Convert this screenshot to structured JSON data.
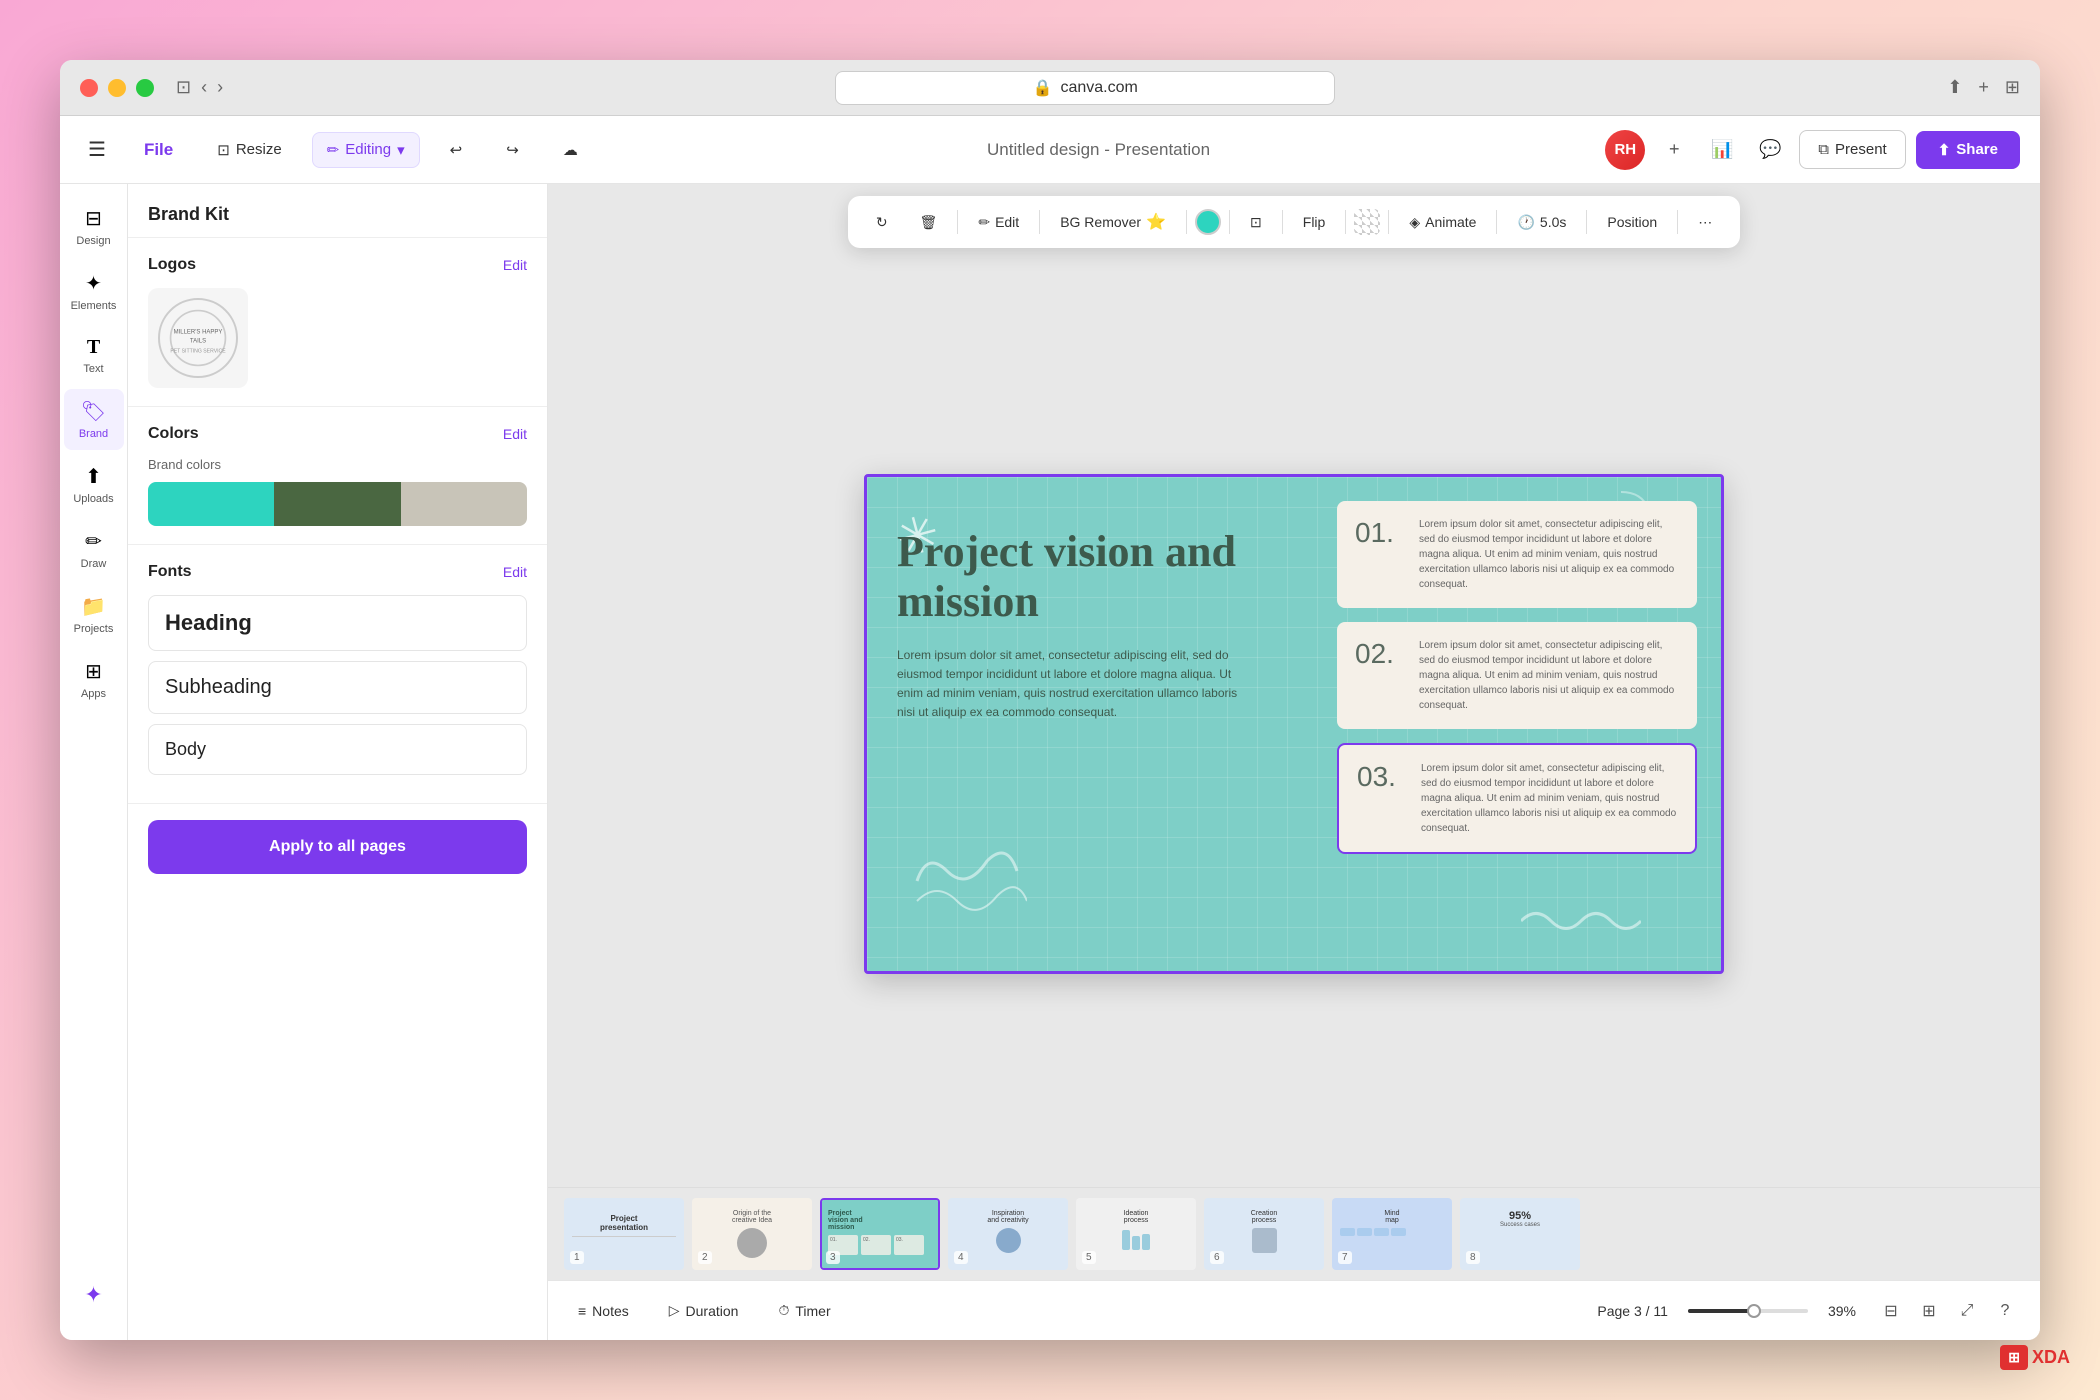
{
  "window": {
    "url": "canva.com",
    "title": "Untitled design - Presentation"
  },
  "toolbar": {
    "hamburger": "☰",
    "file": "File",
    "resize": "Resize",
    "editing": "Editing",
    "undo": "↩",
    "redo": "↪",
    "cloud": "☁",
    "title": "Untitled design - Presentation",
    "avatar": "RH",
    "add": "+",
    "chart": "📊",
    "comment": "💬",
    "present": "Present",
    "share": "Share"
  },
  "floating_toolbar": {
    "refresh": "↻",
    "trash": "🗑",
    "edit": "Edit",
    "bg_remover": "BG Remover",
    "flip": "Flip",
    "animate": "Animate",
    "duration": "5.0s",
    "position": "Position"
  },
  "left_panel": {
    "title": "Brand Kit",
    "logos_section": "Logos",
    "logos_edit": "Edit",
    "colors_section": "Colors",
    "colors_edit": "Edit",
    "brand_colors_label": "Brand colors",
    "fonts_section": "Fonts",
    "fonts_edit": "Edit",
    "heading_label": "Heading",
    "subheading_label": "Subheading",
    "body_label": "Body",
    "apply_button": "Apply to all pages"
  },
  "sidebar_icons": [
    {
      "icon": "☰",
      "label": "Design",
      "active": false
    },
    {
      "icon": "✦",
      "label": "Elements",
      "active": false
    },
    {
      "icon": "T",
      "label": "Text",
      "active": false
    },
    {
      "icon": "🏷",
      "label": "Brand",
      "active": true
    },
    {
      "icon": "⬆",
      "label": "Uploads",
      "active": false
    },
    {
      "icon": "✏",
      "label": "Draw",
      "active": false
    },
    {
      "icon": "📁",
      "label": "Projects",
      "active": false
    },
    {
      "icon": "⊞",
      "label": "Apps",
      "active": false
    }
  ],
  "colors": [
    {
      "hex": "#2dd4bf"
    },
    {
      "hex": "#4a6741"
    },
    {
      "hex": "#c8c4b8"
    }
  ],
  "slide": {
    "title": "Project vision and mission",
    "body_text": "Lorem ipsum dolor sit amet, consectetur adipiscing elit, sed do eiusmod tempor incididunt ut labore et dolore magna aliqua. Ut enim ad minim veniam, quis nostrud exercitation ullamco laboris nisi ut aliquip ex ea commodo consequat.",
    "cards": [
      {
        "number": "01.",
        "text": "Lorem ipsum dolor sit amet, consectetur adipiscing elit, sed do eiusmod tempor incididunt ut labore et dolore magna aliqua. Ut enim ad minim veniam, quis nostrud exercitation ullamco laboris nisi ut aliquip ex ea commodo consequat."
      },
      {
        "number": "02.",
        "text": "Lorem ipsum dolor sit amet, consectetur adipiscing elit, sed do eiusmod tempor incididunt ut labore et dolore magna aliqua. Ut enim ad minim veniam, quis nostrud exercitation ullamco laboris nisi ut aliquip ex ea commodo consequat."
      },
      {
        "number": "03.",
        "text": "Lorem ipsum dolor sit amet, consectetur adipiscing elit, sed do eiusmod tempor incididunt ut labore et dolore magna aliqua. Ut enim ad minim veniam, quis nostrud exercitation ullamco laboris nisi ut aliquip ex ea commodo consequat.",
        "active": true
      }
    ]
  },
  "thumbnails": [
    {
      "id": 1,
      "label": "Project presentation",
      "bg": "blue",
      "number": "1"
    },
    {
      "id": 2,
      "label": "Origin of the creative Idea",
      "bg": "beige",
      "number": "2"
    },
    {
      "id": 3,
      "label": "Project vision and mission",
      "bg": "teal",
      "number": "3",
      "active": true
    },
    {
      "id": 4,
      "label": "Inspiration and creativity",
      "bg": "blue",
      "number": "4"
    },
    {
      "id": 5,
      "label": "Ideation process",
      "bg": "white",
      "number": "5"
    },
    {
      "id": 6,
      "label": "Creation process",
      "bg": "blue",
      "number": "6"
    },
    {
      "id": 7,
      "label": "Mind map",
      "bg": "lightblue",
      "number": "7"
    },
    {
      "id": 8,
      "label": "95% Success cases",
      "bg": "blue",
      "number": "8"
    }
  ],
  "bottom_bar": {
    "notes": "Notes",
    "duration": "Duration",
    "timer": "Timer",
    "page": "Page 3 / 11",
    "zoom": "39%"
  }
}
